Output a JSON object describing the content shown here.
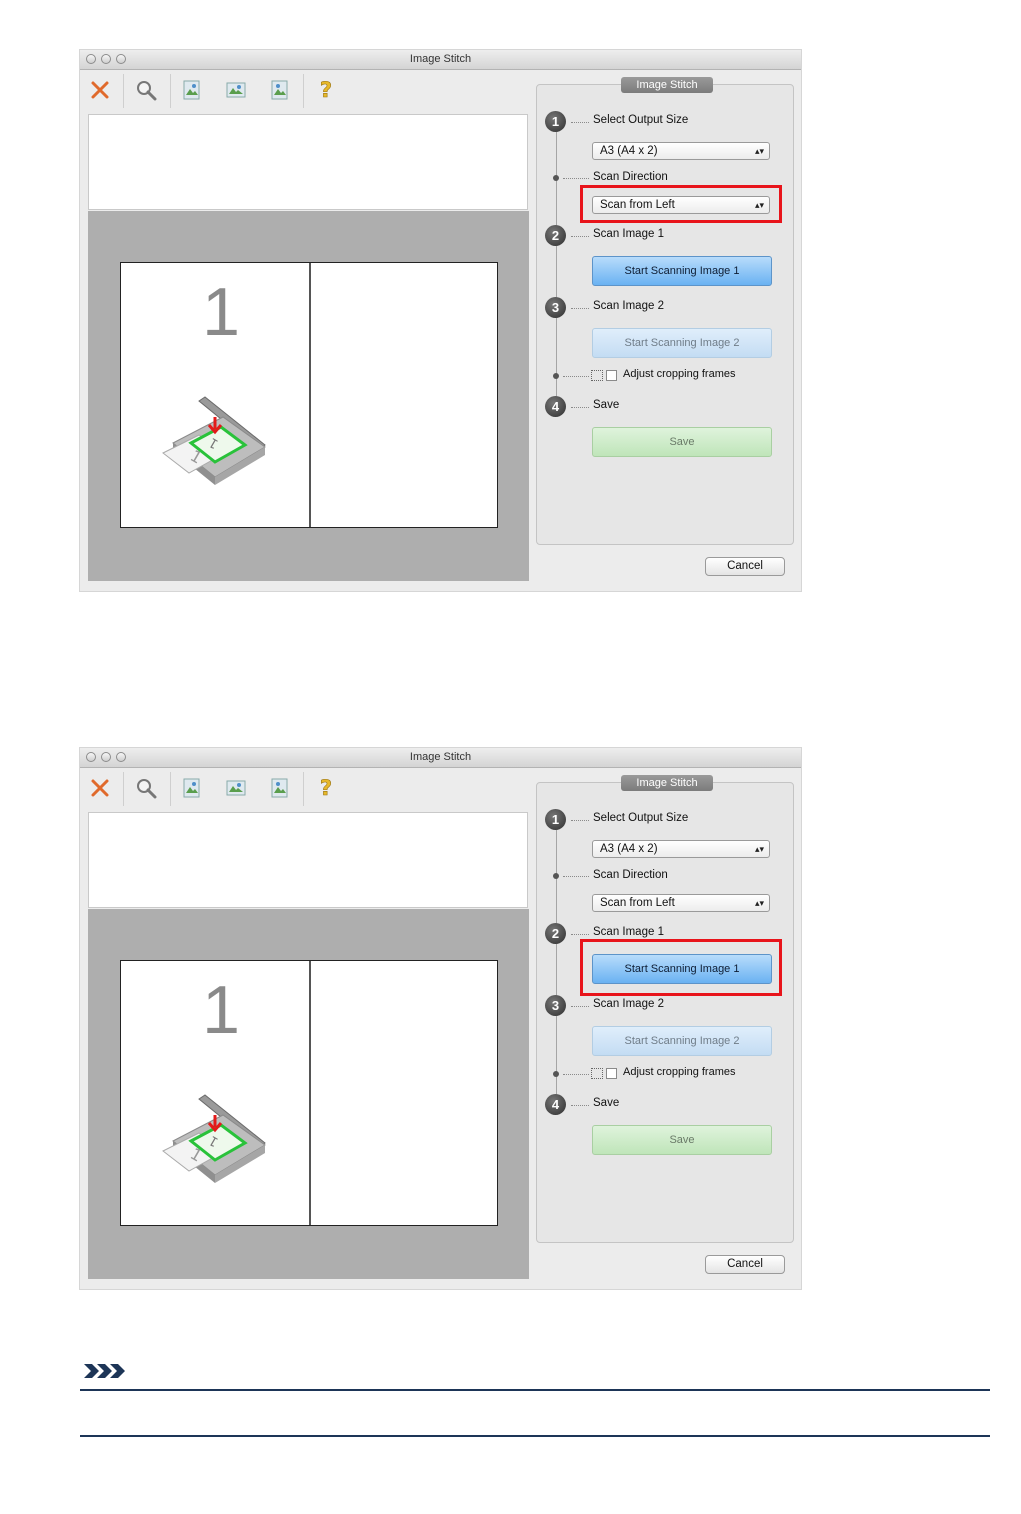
{
  "window": {
    "title": "Image Stitch"
  },
  "toolbar": {
    "icons": [
      "close-icon",
      "zoom-icon",
      "image-stitch-icon-1",
      "image-stitch-icon-2",
      "image-stitch-icon-3",
      "help-icon"
    ]
  },
  "preview": {
    "page_number": "1"
  },
  "panel": {
    "title": "Image Stitch",
    "steps": {
      "step1": {
        "number": "1",
        "label": "Select Output Size"
      },
      "scan_direction": {
        "label": "Scan Direction"
      },
      "step2": {
        "number": "2",
        "label": "Scan Image 1"
      },
      "step3": {
        "number": "3",
        "label": "Scan Image 2"
      },
      "adjust": {
        "label": "Adjust cropping frames"
      },
      "step4": {
        "number": "4",
        "label": "Save"
      }
    },
    "output_size_value": "A3 (A4 x 2)",
    "scan_direction_value": "Scan from Left",
    "start_scan_1": "Start Scanning Image 1",
    "start_scan_2": "Start Scanning Image 2",
    "save_button": "Save",
    "adjust_checked": false
  },
  "cancel_button": "Cancel",
  "colors": {
    "highlight": "#e8141b",
    "active_button": "#6ab2f2",
    "save_button": "#bfe5b9",
    "note_icon": "#1d3557"
  }
}
